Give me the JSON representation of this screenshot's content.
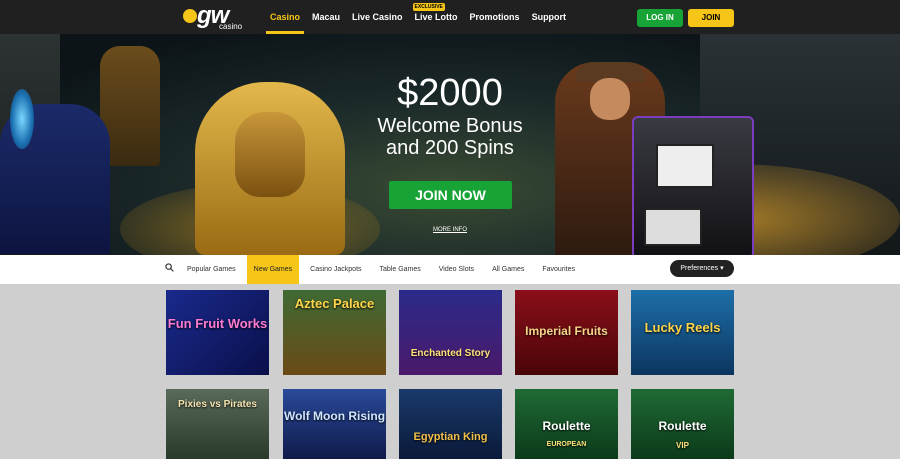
{
  "header": {
    "logo_text": "gw",
    "logo_sub": "casino",
    "nav": [
      {
        "label": "Casino",
        "active": true
      },
      {
        "label": "Macau"
      },
      {
        "label": "Live Casino"
      },
      {
        "label": "Live Lotto",
        "badge": "EXCLUSIVE"
      },
      {
        "label": "Promotions"
      },
      {
        "label": "Support"
      }
    ],
    "login_label": "LOG IN",
    "join_label": "JOIN"
  },
  "hero": {
    "amount": "$2000",
    "line1": "Welcome Bonus",
    "line2": "and 200 Spins",
    "cta_label": "JOIN NOW",
    "more_info": "MORE INFO"
  },
  "categories": {
    "items": [
      "Popular Games",
      "New Games",
      "Casino Jackpots",
      "Table Games",
      "Video Slots",
      "All Games",
      "Favourites"
    ],
    "active_index": 1,
    "preferences_label": "Preferences"
  },
  "games": [
    {
      "name": "Fun Fruit Works"
    },
    {
      "name": "Aztec Palace"
    },
    {
      "name": "Enchanted Story"
    },
    {
      "name": "Imperial Fruits"
    },
    {
      "name": "Lucky Reels"
    },
    {
      "name": "Pixies vs Pirates"
    },
    {
      "name": "Wolf Moon Rising"
    },
    {
      "name": "Egyptian King"
    },
    {
      "name": "Roulette",
      "sub": "EUROPEAN"
    },
    {
      "name": "Roulette",
      "sub": "VIP"
    }
  ],
  "colors": {
    "accent": "#f5c518",
    "green": "#17a336",
    "dark": "#202020"
  }
}
